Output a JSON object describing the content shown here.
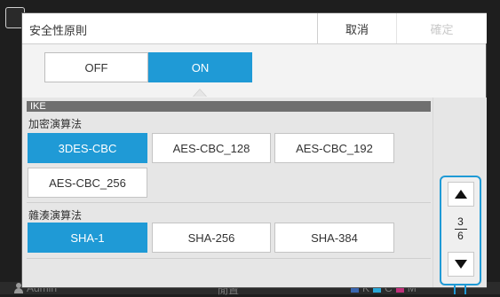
{
  "dialog": {
    "title": "安全性原則",
    "cancel_label": "取消",
    "confirm_label": "確定"
  },
  "toggle": {
    "off_label": "OFF",
    "on_label": "ON",
    "selected": "ON"
  },
  "section": {
    "header": "IKE",
    "encryption": {
      "label": "加密演算法",
      "options": [
        "3DES-CBC",
        "AES-CBC_128",
        "AES-CBC_192",
        "AES-CBC_256"
      ],
      "selected": "3DES-CBC"
    },
    "hash": {
      "label": "雜湊演算法",
      "options": [
        "SHA-1",
        "SHA-256",
        "SHA-384"
      ],
      "selected": "SHA-1"
    }
  },
  "pager": {
    "current": "3",
    "total": "6"
  },
  "background": {
    "user": "Admin",
    "status": "閒置",
    "ink_label": "K",
    "ink_c": "C",
    "ink_m": "M"
  },
  "colors": {
    "accent": "#1f9ad6",
    "section_header": "#6f6f6f",
    "content_bg": "#e6e6e6"
  }
}
